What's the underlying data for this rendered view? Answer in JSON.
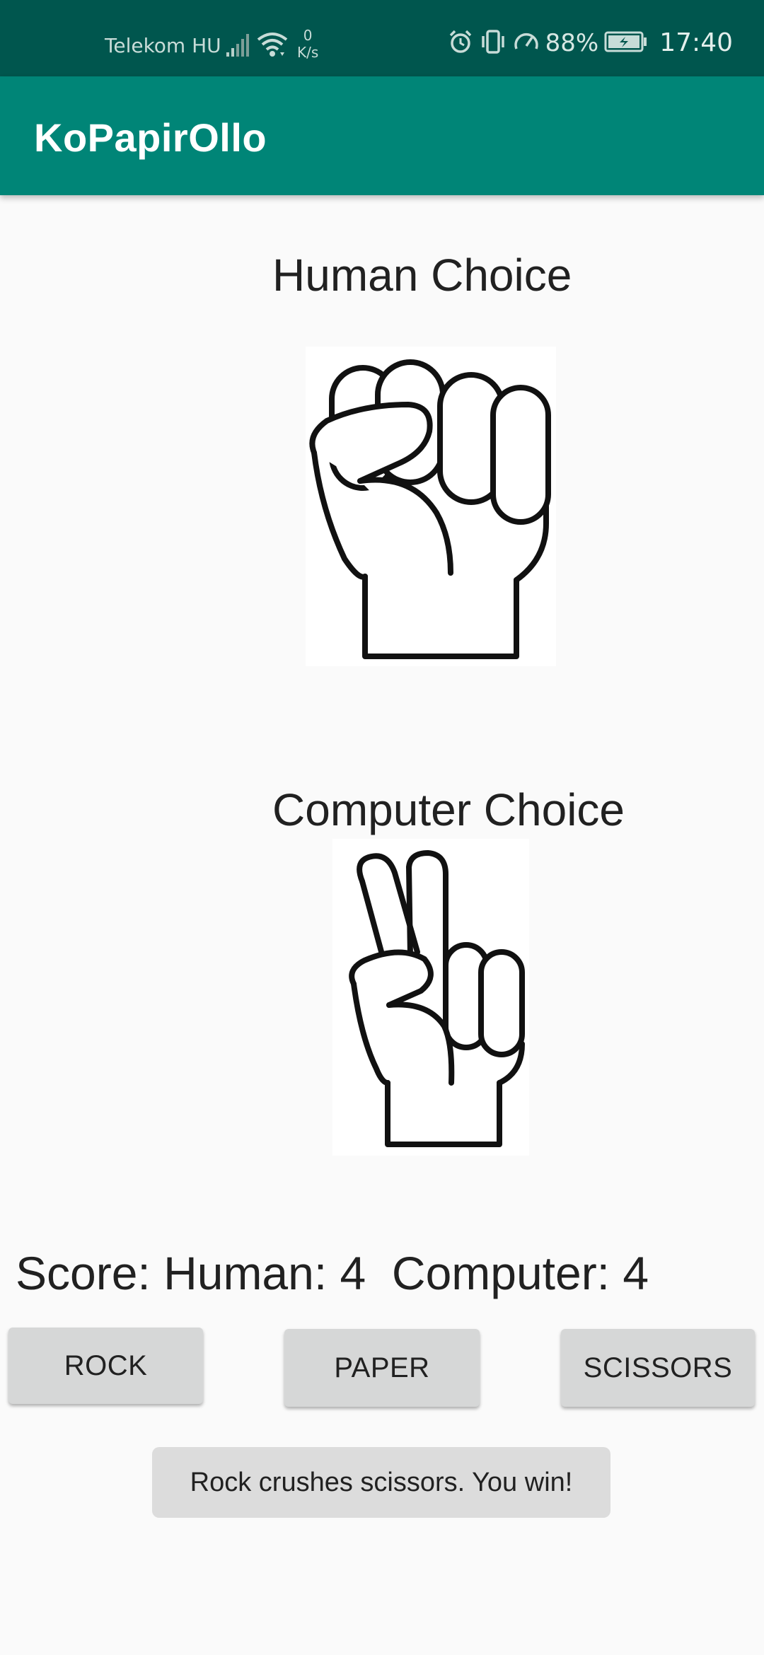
{
  "status_bar": {
    "carrier": "Telekom HU",
    "net_speed_value": "0",
    "net_speed_unit": "K/s",
    "battery_percent": "88%",
    "time": "17:40",
    "icons": [
      "signal-icon",
      "wifi-icon",
      "alarm-icon",
      "vibrate-icon",
      "speed-icon",
      "battery-icon"
    ]
  },
  "app_bar": {
    "title": "KoPapirOllo"
  },
  "human": {
    "label": "Human Choice",
    "choice_image": "rock-hand-icon"
  },
  "computer": {
    "label": "Computer Choice",
    "choice_image": "scissors-hand-icon"
  },
  "score": {
    "text": "Score: Human: 4  Computer: 4"
  },
  "buttons": {
    "rock": "ROCK",
    "paper": "PAPER",
    "scissors": "SCISSORS"
  },
  "result": {
    "text": "Rock crushes scissors. You win!"
  },
  "colors": {
    "status_bar": "#00564e",
    "app_bar": "#008577",
    "background": "#fafafa",
    "button": "#d6d7d7"
  }
}
